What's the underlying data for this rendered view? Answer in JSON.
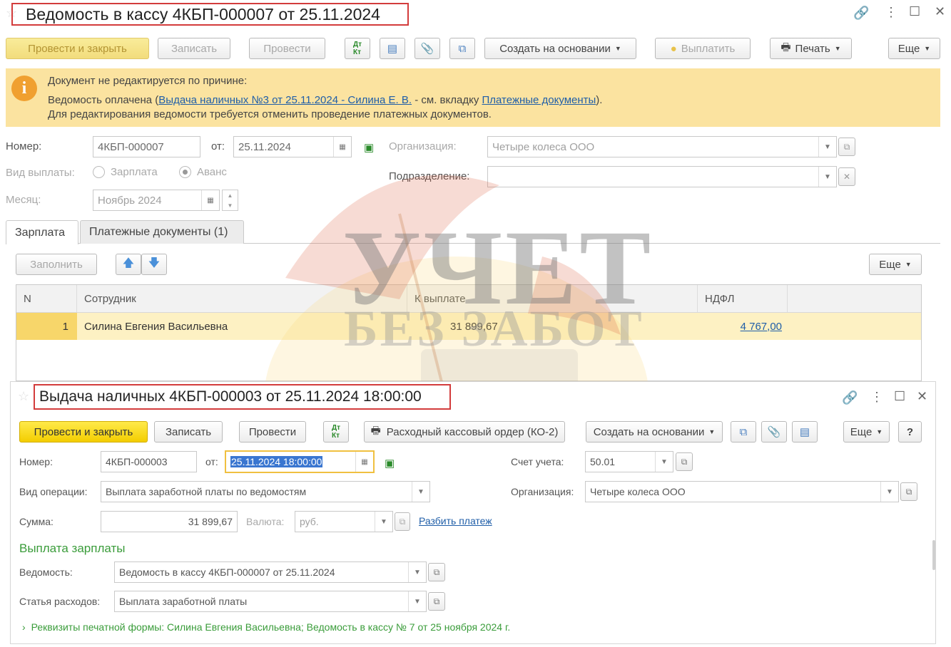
{
  "doc1": {
    "title": "Ведомость в кассу 4КБП-000007 от 25.11.2024",
    "toolbar": {
      "post_close": "Провести и закрыть",
      "save": "Записать",
      "post": "Провести",
      "create_basis": "Создать на основании",
      "pay": "Выплатить",
      "print": "Печать",
      "more": "Еще"
    },
    "notice": {
      "line1": "Документ не редактируется по причине:",
      "line2_pre": "Ведомость оплачена (",
      "line2_link": "Выдача наличных №3 от 25.11.2024 - Силина Е. В.",
      "line2_mid": " - см. вкладку ",
      "line2_link2": "Платежные документы",
      "line2_post": ").",
      "line3": "Для редактирования ведомости требуется отменить проведение платежных документов."
    },
    "fields": {
      "number_label": "Номер:",
      "number_value": "4КБП-000007",
      "from_label": "от:",
      "date_value": "25.11.2024",
      "org_label": "Организация:",
      "org_value": "Четыре колеса ООО",
      "pay_type_label": "Вид выплаты:",
      "pay_type_salary": "Зарплата",
      "pay_type_advance": "Аванс",
      "selected_pay_type": "Аванс",
      "division_label": "Подразделение:",
      "division_value": "",
      "month_label": "Месяц:",
      "month_value": "Ноябрь 2024"
    },
    "tabs": [
      "Зарплата",
      "Платежные документы (1)"
    ],
    "table_toolbar": {
      "fill": "Заполнить",
      "more": "Еще"
    },
    "table": {
      "columns": [
        "N",
        "Сотрудник",
        "К выплате",
        "НДФЛ"
      ],
      "rows": [
        {
          "n": "1",
          "employee": "Силина Евгения Васильевна",
          "to_pay": "31 899,67",
          "ndfl": "4 767,00"
        }
      ]
    }
  },
  "doc2": {
    "title": "Выдача наличных 4КБП-000003 от 25.11.2024 18:00:00",
    "toolbar": {
      "post_close": "Провести и закрыть",
      "save": "Записать",
      "post": "Провести",
      "cash_order": "Расходный кассовый ордер (КО-2)",
      "create_basis": "Создать на основании",
      "more": "Еще",
      "help": "?"
    },
    "fields": {
      "number_label": "Номер:",
      "number_value": "4КБП-000003",
      "from_label": "от:",
      "date_value": "25.11.2024 18:00:00",
      "account_label": "Счет учета:",
      "account_value": "50.01",
      "operation_label": "Вид операции:",
      "operation_value": "Выплата заработной платы по ведомостям",
      "org_label": "Организация:",
      "org_value": "Четыре колеса ООО",
      "sum_label": "Сумма:",
      "sum_value": "31 899,67",
      "currency_label": "Валюта:",
      "currency_value": "руб.",
      "split_link": "Разбить платеж"
    },
    "section_title": "Выплата зарплаты",
    "statement_label": "Ведомость:",
    "statement_value": "Ведомость в кассу 4КБП-000007 от 25.11.2024",
    "expense_label": "Статья расходов:",
    "expense_value": "Выплата заработной платы",
    "print_details": "Реквизиты печатной формы: Силина Евгения Васильевна; Ведомость в кассу № 7 от 25 ноября 2024 г."
  },
  "watermark": {
    "line1": "УЧЕТ",
    "line2": "БЕЗ ЗАБОТ"
  },
  "colors": {
    "accent_yellow": "#f3cd00",
    "notice_bg": "#fbe3a0",
    "row_highlight": "#fdf1c3",
    "title_border": "#d33c3c",
    "link": "#1f5ea8"
  }
}
